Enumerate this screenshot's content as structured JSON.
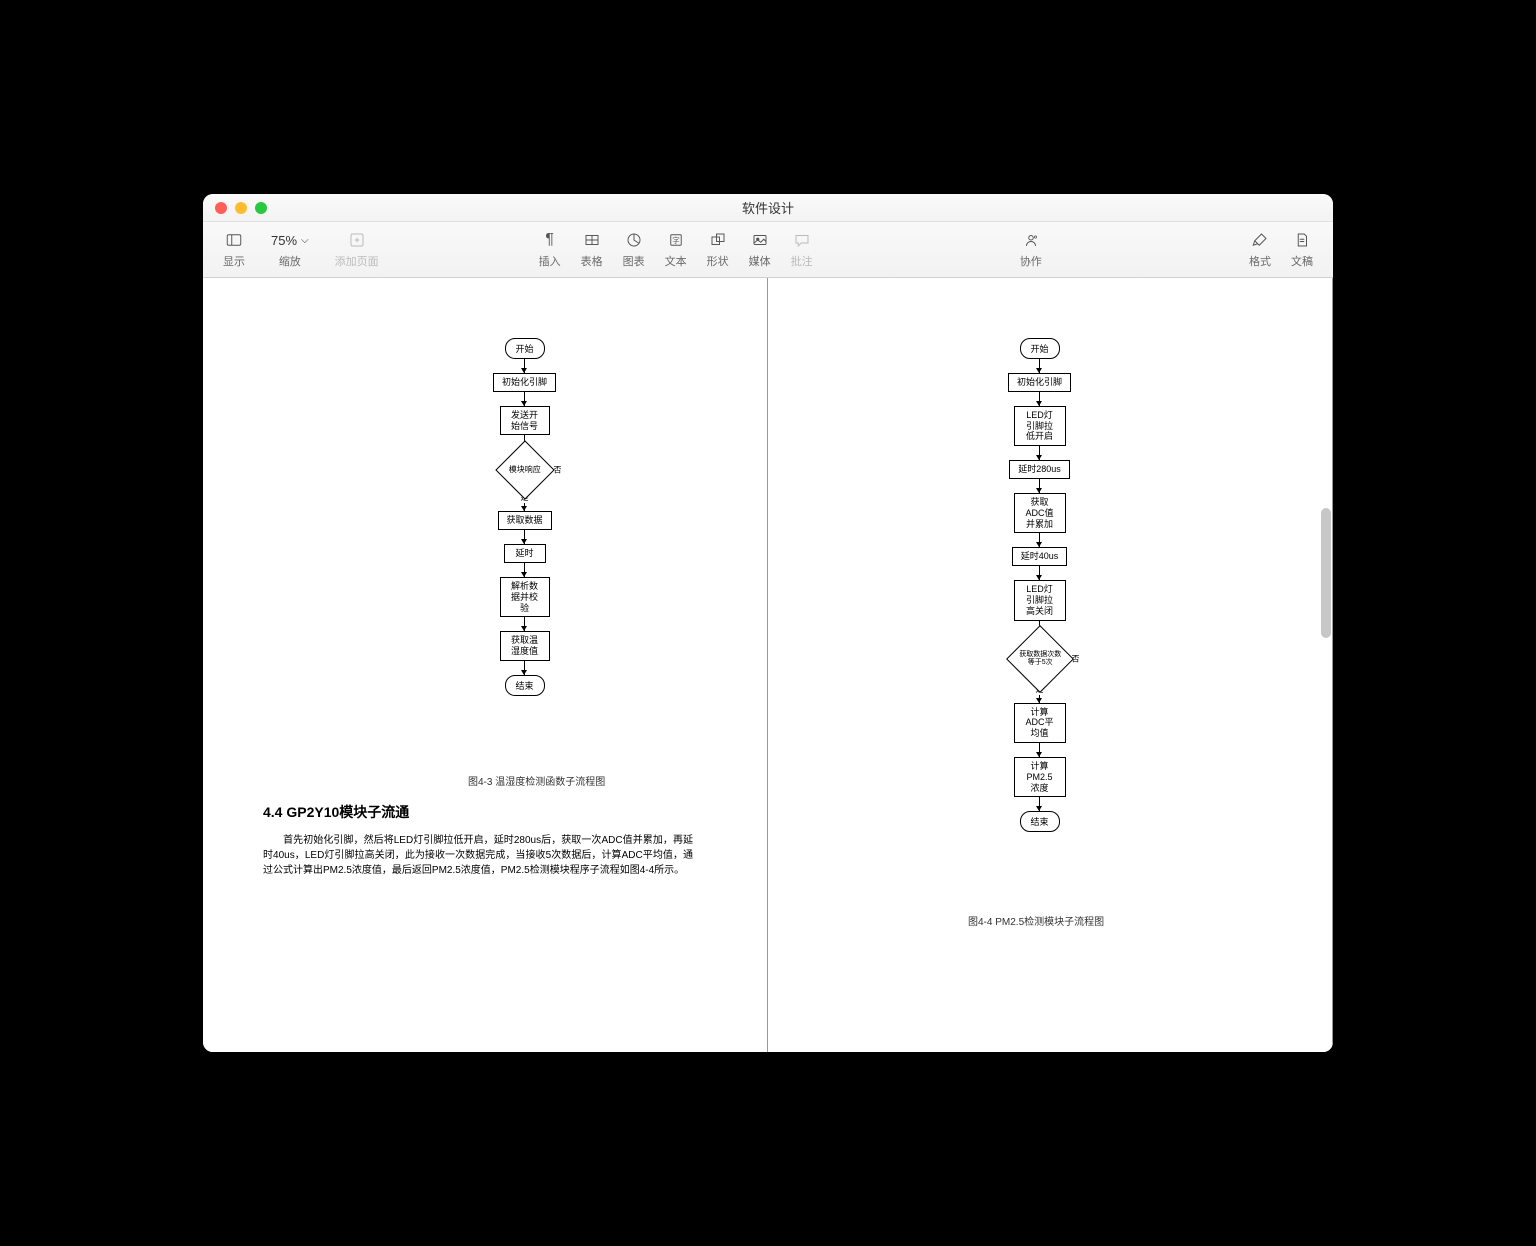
{
  "window": {
    "title": "软件设计"
  },
  "toolbar": {
    "display_label": "显示",
    "zoom_value": "75%",
    "zoom_label": "缩放",
    "add_page_label": "添加页面",
    "insert_label": "插入",
    "table_label": "表格",
    "chart_label": "图表",
    "text_label": "文本",
    "shape_label": "形状",
    "media_label": "媒体",
    "annotation_label": "批注",
    "collaborate_label": "协作",
    "format_label": "格式",
    "document_label": "文稿"
  },
  "flowchart_left": {
    "start": "开始",
    "b1": "初始化引脚",
    "b2": "发送开始信号",
    "decision": "模块响应",
    "dec_no": "否",
    "dec_yes": "是",
    "b3": "获取数据",
    "b4": "延时",
    "b5": "解析数据并校验",
    "b6": "获取温湿度值",
    "end": "结束",
    "caption": "图4-3 温湿度检测函数子流程图"
  },
  "heading": "4.4 GP2Y10模块子流通",
  "paragraph": "　　首先初始化引脚，然后将LED灯引脚拉低开启，延时280us后，获取一次ADC值并累加，再延时40us，LED灯引脚拉高关闭，此为接收一次数据完成，当接收5次数据后，计算ADC平均值，通过公式计算出PM2.5浓度值，最后返回PM2.5浓度值，PM2.5检测模块程序子流程如图4-4所示。",
  "flowchart_right": {
    "start": "开始",
    "b1": "初始化引脚",
    "b2": "LED灯引脚拉低开启",
    "b3": "延时280us",
    "b4": "获取ADC值并累加",
    "b5": "延时40us",
    "b6": "LED灯引脚拉高关闭",
    "decision": "获取数据次数等于5次",
    "dec_no": "否",
    "dec_yes": "是",
    "b7": "计算ADC平均值",
    "b8": "计算PM2.5浓度",
    "end": "结束",
    "caption": "图4-4 PM2.5检测模块子流程图"
  }
}
